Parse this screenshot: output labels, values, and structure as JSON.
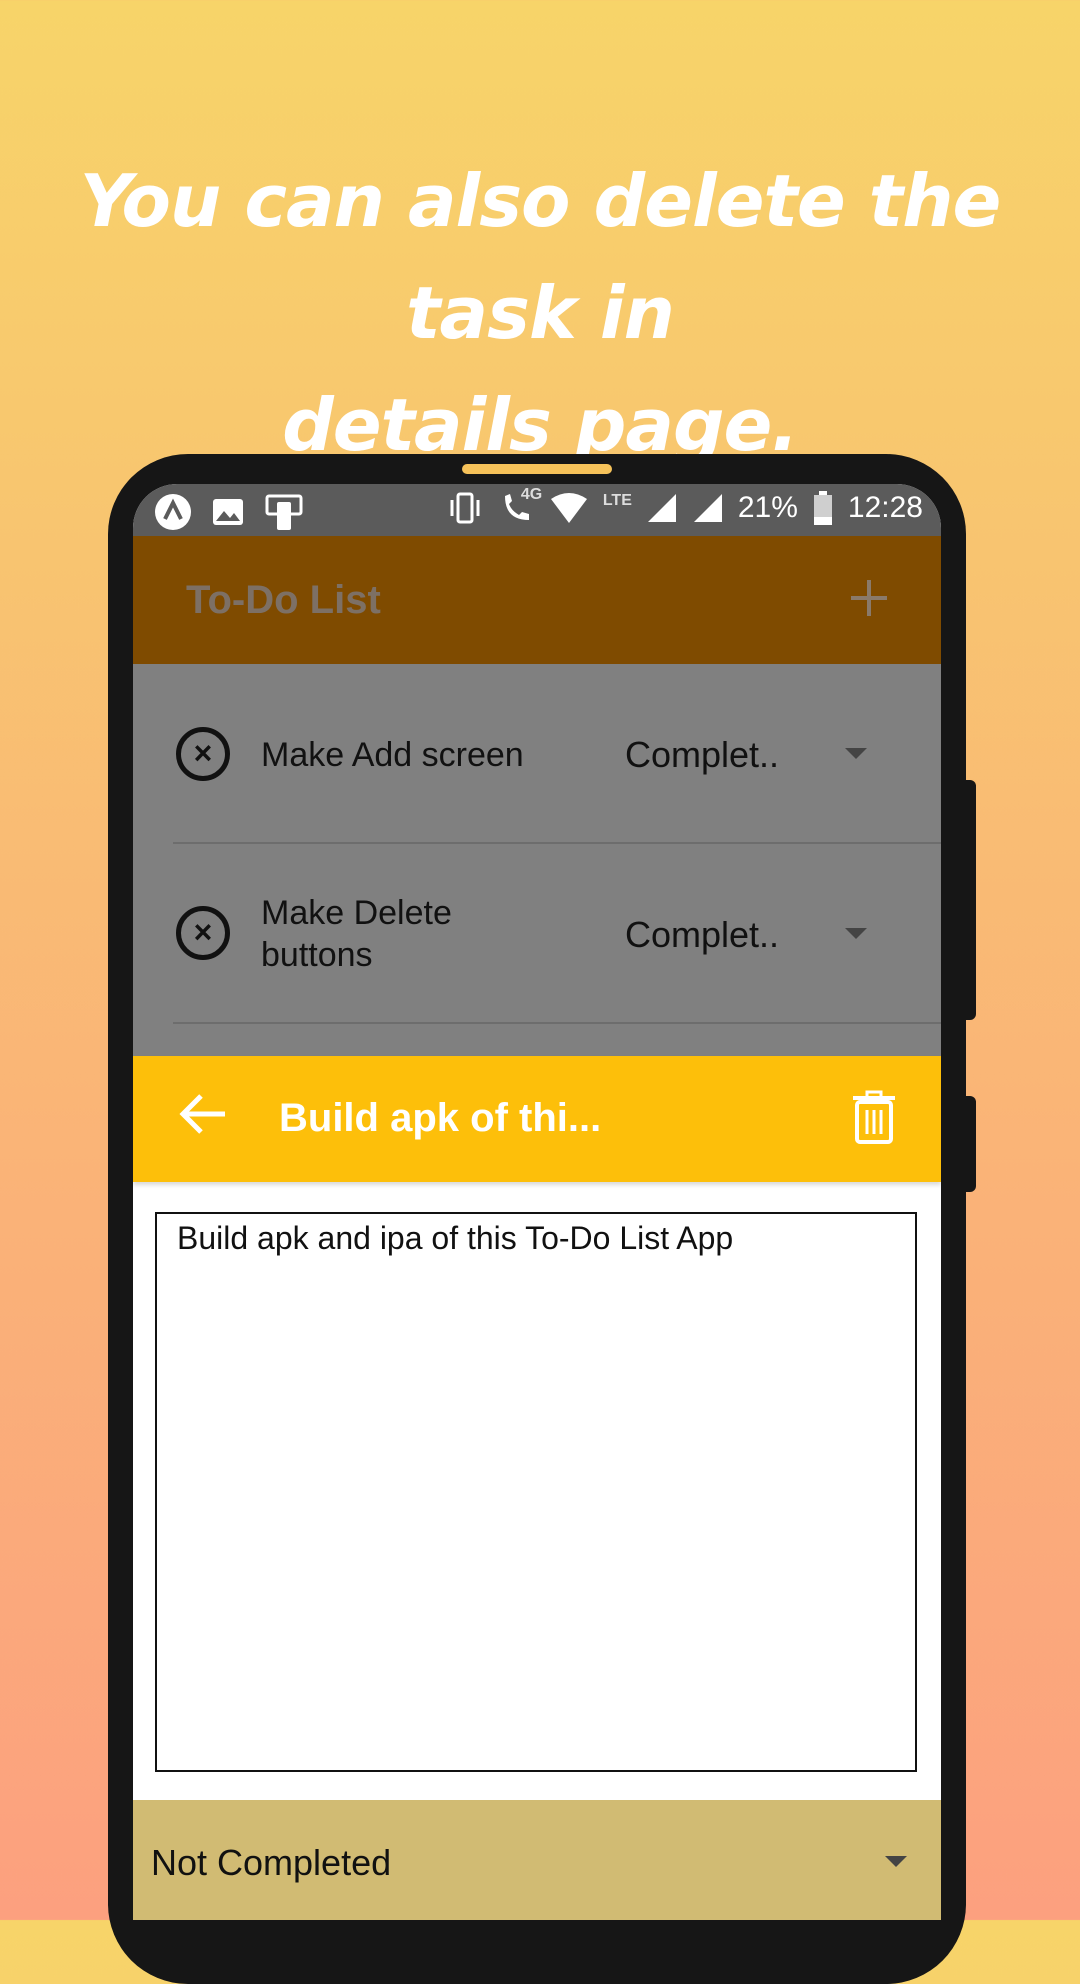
{
  "headline": {
    "line1": "You can also delete the task in",
    "line2": "details page."
  },
  "status_bar": {
    "network": "4G",
    "lte": "LTE",
    "battery": "21%",
    "time": "12:28"
  },
  "app_bar": {
    "title": "To-Do List",
    "add_icon": "plus-icon"
  },
  "tasks": [
    {
      "label": "Make Add screen",
      "status": "Complet..",
      "delete_icon": "close-circle-icon"
    },
    {
      "label": "Make Delete buttons",
      "status": "Complet..",
      "delete_icon": "close-circle-icon"
    }
  ],
  "detail": {
    "back_icon": "arrow-left-icon",
    "title": "Build apk of thi...",
    "delete_icon": "trash-icon",
    "description": "Build apk and ipa of this To-Do List App",
    "status": "Not Completed"
  },
  "colors": {
    "app_bar": "#7f4b00",
    "detail_bar": "#fdbf0a",
    "status_dropdown": "#d1bb73",
    "list_overlay": "#808080"
  }
}
